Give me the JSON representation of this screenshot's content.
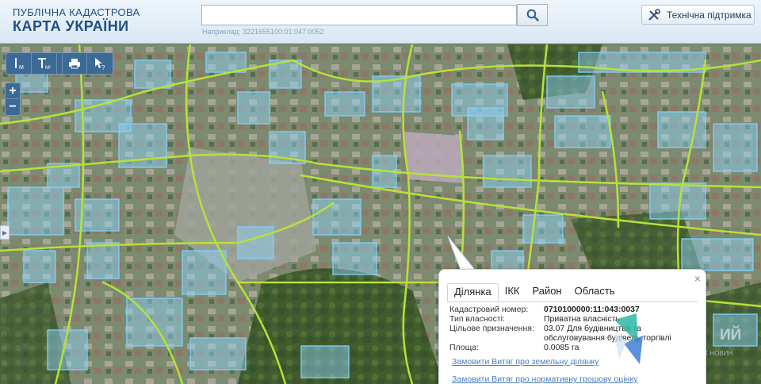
{
  "header": {
    "logo_line1": "ПУБЛІЧНА КАДАСТРОВА",
    "logo_line2": "КАРТА УКРАЇНИ",
    "search_value": "",
    "search_hint": "Наприклад: 3221655100:01:047:0052",
    "support_label": "Технічна підтримка"
  },
  "toolbar": {
    "tools": [
      {
        "name": "measure-length-icon",
        "sub": "М"
      },
      {
        "name": "measure-area-icon",
        "sub": "М²"
      },
      {
        "name": "print-icon"
      },
      {
        "name": "identify-pointer-icon"
      }
    ],
    "zoom_in": "+",
    "zoom_out": "−",
    "side_handle": "▶"
  },
  "popup": {
    "tabs": [
      "Ділянка",
      "ІКК",
      "Район",
      "Область"
    ],
    "active_tab": "Ділянка",
    "close": "×",
    "fields": [
      {
        "key": "Кадастровий номер:",
        "value": "0710100000:11:043:0037",
        "bold": true
      },
      {
        "key": "Тип власності:",
        "value": "Приватна власність"
      },
      {
        "key": "Цільове призначення:",
        "value": "03.07 Для будівництва та обслуговування будівель торгівлі"
      },
      {
        "key": "Площа:",
        "value": "0.0085 га"
      }
    ],
    "link1": "Замовити Витяг про земельну ділянку",
    "link2": "Замовити Витяг про нормативну грошову оцінку"
  },
  "watermark": {
    "text": "ИЙ",
    "sub": "ИХ НОВИН"
  },
  "colors": {
    "accent": "#1f4f86",
    "roads": "#b6e23a",
    "parcels": "#7fd0ff",
    "toolbar": "#3b6a96"
  }
}
